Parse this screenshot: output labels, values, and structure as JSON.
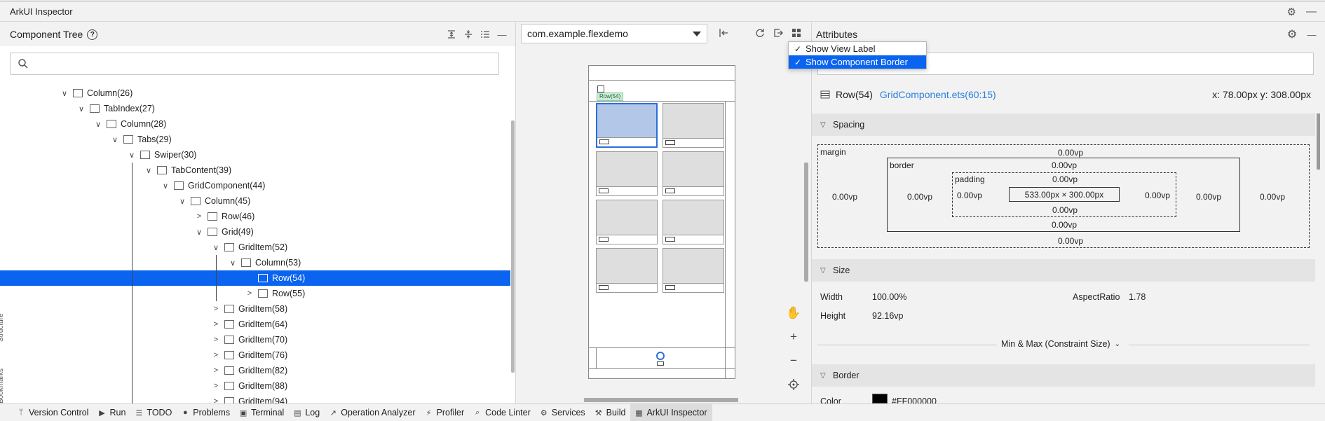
{
  "app": {
    "title": "ArkUI Inspector"
  },
  "component_tree": {
    "title": "Component Tree",
    "help_label": "?",
    "search_placeholder": "",
    "nodes": [
      {
        "label": "Column(26)",
        "depth": 0,
        "expanded": true,
        "icon": "column-icon"
      },
      {
        "label": "TabIndex(27)",
        "depth": 1,
        "expanded": true,
        "icon": "tabindex-icon"
      },
      {
        "label": "Column(28)",
        "depth": 2,
        "expanded": true,
        "icon": "column-icon"
      },
      {
        "label": "Tabs(29)",
        "depth": 3,
        "expanded": true,
        "icon": "folder-icon"
      },
      {
        "label": "Swiper(30)",
        "depth": 4,
        "expanded": true,
        "icon": "swiper-icon"
      },
      {
        "label": "TabContent(39)",
        "depth": 5,
        "expanded": true,
        "icon": "tabcontent-icon"
      },
      {
        "label": "GridComponent(44)",
        "depth": 6,
        "expanded": true,
        "icon": "component-icon"
      },
      {
        "label": "Column(45)",
        "depth": 7,
        "expanded": true,
        "icon": "column-icon"
      },
      {
        "label": "Row(46)",
        "depth": 8,
        "expanded": false,
        "icon": "row-icon"
      },
      {
        "label": "Grid(49)",
        "depth": 8,
        "expanded": true,
        "icon": "grid-icon"
      },
      {
        "label": "GridItem(52)",
        "depth": 9,
        "expanded": true,
        "icon": "griditem-icon"
      },
      {
        "label": "Column(53)",
        "depth": 10,
        "expanded": true,
        "icon": "column-icon"
      },
      {
        "label": "Row(54)",
        "depth": 11,
        "expanded": null,
        "icon": "row-icon",
        "selected": true
      },
      {
        "label": "Row(55)",
        "depth": 11,
        "expanded": false,
        "icon": "row-icon"
      },
      {
        "label": "GridItem(58)",
        "depth": 9,
        "expanded": false,
        "icon": "griditem-icon"
      },
      {
        "label": "GridItem(64)",
        "depth": 9,
        "expanded": false,
        "icon": "griditem-icon"
      },
      {
        "label": "GridItem(70)",
        "depth": 9,
        "expanded": false,
        "icon": "griditem-icon"
      },
      {
        "label": "GridItem(76)",
        "depth": 9,
        "expanded": false,
        "icon": "griditem-icon"
      },
      {
        "label": "GridItem(82)",
        "depth": 9,
        "expanded": false,
        "icon": "griditem-icon"
      },
      {
        "label": "GridItem(88)",
        "depth": 9,
        "expanded": false,
        "icon": "griditem-icon"
      },
      {
        "label": "GridItem(94)",
        "depth": 9,
        "expanded": false,
        "icon": "griditem-icon"
      }
    ],
    "side_tabs": [
      "Structure",
      "Bookmarks"
    ]
  },
  "preview": {
    "package": "com.example.flexdemo",
    "label_tag": "Row(54)"
  },
  "view_menu": {
    "items": [
      {
        "label": "Show View Label",
        "checked": true
      },
      {
        "label": "Show Component Border",
        "checked": true,
        "highlighted": true
      }
    ]
  },
  "attributes": {
    "title": "Attributes",
    "component": "Row(54)",
    "source_link": "GridComponent.ets(60:15)",
    "coords": "x: 78.00px  y: 308.00px",
    "spacing": {
      "title": "Spacing",
      "margin_label": "margin",
      "border_label": "border",
      "padding_label": "padding",
      "margin": {
        "top": "0.00vp",
        "bottom": "0.00vp",
        "left": "0.00vp",
        "right": "0.00vp"
      },
      "border": {
        "top": "0.00vp",
        "bottom": "0.00vp",
        "left": "0.00vp",
        "right": "0.00vp"
      },
      "padding": {
        "top": "0.00vp",
        "bottom": "0.00vp",
        "left": "0.00vp",
        "right": "0.00vp"
      },
      "content": "533.00px × 300.00px"
    },
    "size": {
      "title": "Size",
      "width_label": "Width",
      "width": "100.00%",
      "height_label": "Height",
      "height": "92.16vp",
      "aspect_label": "AspectRatio",
      "aspect": "1.78",
      "minmax": "Min & Max (Constraint Size)"
    },
    "border_section": {
      "title": "Border",
      "color_label": "Color",
      "color_value": "#FF000000",
      "swatch": "#000000"
    }
  },
  "bottom_bar": {
    "items": [
      {
        "label": "Version Control",
        "icon": "branch-icon"
      },
      {
        "label": "Run",
        "icon": "run-icon"
      },
      {
        "label": "TODO",
        "icon": "list-icon"
      },
      {
        "label": "Problems",
        "icon": "problems-icon"
      },
      {
        "label": "Terminal",
        "icon": "terminal-icon"
      },
      {
        "label": "Log",
        "icon": "log-icon"
      },
      {
        "label": "Operation Analyzer",
        "icon": "analyzer-icon"
      },
      {
        "label": "Profiler",
        "icon": "profiler-icon"
      },
      {
        "label": "Code Linter",
        "icon": "linter-icon"
      },
      {
        "label": "Services",
        "icon": "services-icon"
      },
      {
        "label": "Build",
        "icon": "build-icon"
      },
      {
        "label": "ArkUI Inspector",
        "icon": "inspector-icon",
        "active": true
      }
    ]
  },
  "colors": {
    "selection": "#0a64f0",
    "link": "#2a7fde",
    "highlight_cell": "#b3c8e8"
  }
}
